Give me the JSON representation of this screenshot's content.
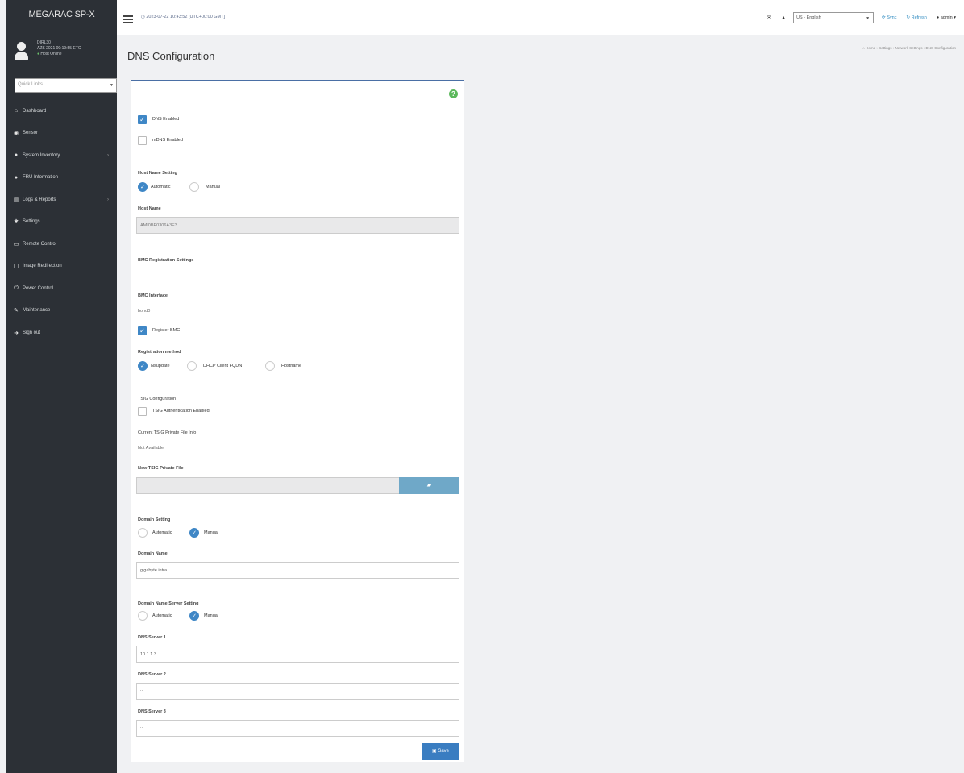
{
  "sidebar": {
    "brand": "MEGARAC SP-X",
    "user": {
      "name": "DIRL30",
      "line2": "AZS 2021 09:19:55 ETC",
      "status": "Host Online"
    },
    "quick_links_placeholder": "Quick Links...",
    "items": [
      {
        "label": "Dashboard",
        "icon": "home-icon",
        "glyph": "⌂",
        "has_children": false
      },
      {
        "label": "Sensor",
        "icon": "sensor-icon",
        "glyph": "◉",
        "has_children": false
      },
      {
        "label": "System Inventory",
        "icon": "inventory-icon",
        "glyph": "●",
        "has_children": true
      },
      {
        "label": "FRU Information",
        "icon": "info-icon",
        "glyph": "●",
        "has_children": false
      },
      {
        "label": "Logs & Reports",
        "icon": "chart-icon",
        "glyph": "▥",
        "has_children": true
      },
      {
        "label": "Settings",
        "icon": "gear-icon",
        "glyph": "✱",
        "has_children": false
      },
      {
        "label": "Remote Control",
        "icon": "monitor-icon",
        "glyph": "▭",
        "has_children": false
      },
      {
        "label": "Image Redirection",
        "icon": "image-icon",
        "glyph": "▢",
        "has_children": false
      },
      {
        "label": "Power Control",
        "icon": "power-icon",
        "glyph": "⏻",
        "has_children": false
      },
      {
        "label": "Maintenance",
        "icon": "wrench-icon",
        "glyph": "✎",
        "has_children": false
      },
      {
        "label": "Sign out",
        "icon": "signout-icon",
        "glyph": "➜",
        "has_children": false
      }
    ]
  },
  "topbar": {
    "datetime": "2023-07-22 10:43:52 [UTC+00:00 GMT]",
    "language": "US - English",
    "sync_label": "Sync",
    "refresh_label": "Refresh",
    "user_label": "admin"
  },
  "page": {
    "title": "DNS Configuration",
    "breadcrumb": [
      "Home",
      "Settings",
      "Network Settings",
      "DNS Configuration"
    ]
  },
  "form": {
    "dns_enabled": {
      "label": "DNS Enabled",
      "checked": true
    },
    "mdns_enabled": {
      "label": "mDNS Enabled",
      "checked": false
    },
    "host_name_setting": {
      "label": "Host Name Setting",
      "options": [
        "Automatic",
        "Manual"
      ],
      "selected": "Automatic"
    },
    "host_name": {
      "label": "Host Name",
      "value": "AMI0BE0306A3E3"
    },
    "bmc_registration_title": "BMC Registration Settings",
    "bmc_interface": {
      "label": "BMC Interface",
      "value": "bond0"
    },
    "register_bmc": {
      "label": "Register BMC",
      "checked": true
    },
    "registration_method": {
      "label": "Registration method",
      "options": [
        "Nsupdate",
        "DHCP Client FQDN",
        "Hostname"
      ],
      "selected": "Nsupdate"
    },
    "tsig_title": "TSIG Configuration",
    "tsig_auth": {
      "label": "TSIG Authentication Enabled",
      "checked": false
    },
    "current_tsig": {
      "label": "Current TSIG Private File Info",
      "value": "Not Available"
    },
    "new_tsig": {
      "label": "New TSIG Private File",
      "value": ""
    },
    "domain_setting": {
      "label": "Domain Setting",
      "options": [
        "Automatic",
        "Manual"
      ],
      "selected": "Manual"
    },
    "domain_name": {
      "label": "Domain Name",
      "value": "gigabyte.intra"
    },
    "dns_server_setting": {
      "label": "Domain Name Server Setting",
      "options": [
        "Automatic",
        "Manual"
      ],
      "selected": "Manual"
    },
    "dns_server_1": {
      "label": "DNS Server 1",
      "value": "10.1.1.3"
    },
    "dns_server_2": {
      "label": "DNS Server 2",
      "value": "::"
    },
    "dns_server_3": {
      "label": "DNS Server 3",
      "value": "::"
    },
    "save_label": "Save"
  }
}
